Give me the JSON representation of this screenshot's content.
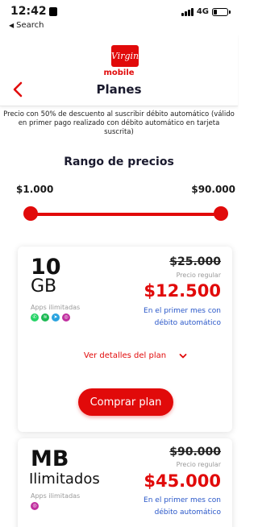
{
  "status_bar": {
    "time": "12:42",
    "back_label": "Search",
    "network": "4G"
  },
  "header": {
    "logo_script": "Virgin",
    "logo_word": "mobile",
    "title": "Planes"
  },
  "promo_text": "Precio con 50% de descuento al suscribir débito automático (válido en primer pago realizado con débito automático en tarjeta suscrita)",
  "price_range": {
    "title": "Rango de precios",
    "min_label": "$1.000",
    "max_label": "$90.000",
    "selected_min_fraction": 0,
    "selected_max_fraction": 1
  },
  "plans": [
    {
      "amount": "10",
      "unit": "GB",
      "apps_label": "Apps ilimitadas",
      "apps": [
        "whatsapp-icon",
        "spotify-icon",
        "telegram-icon",
        "instagram-icon"
      ],
      "old_price": "$25.000",
      "regular_label": "Precio regular",
      "price": "$12.500",
      "promo_note": "En el primer mes con débito automático",
      "details_label": "Ver detalles del plan",
      "buy_label": "Comprar plan"
    },
    {
      "amount": "MB",
      "unit": "Ilimitados",
      "apps_label": "Apps ilimitadas",
      "apps": [
        "instagram-icon"
      ],
      "old_price": "$90.000",
      "regular_label": "Precio regular",
      "price": "$45.000",
      "promo_note": "En el primer mes con débito automático"
    }
  ],
  "colors": {
    "brand_red": "#e10a0a",
    "link_blue": "#2957c9"
  }
}
